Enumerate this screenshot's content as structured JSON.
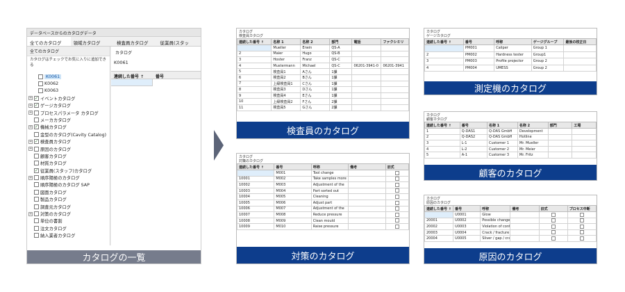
{
  "list_panel": {
    "window_title": "データベースからのカタログデータ",
    "tabs": [
      "全てのカタログ",
      "領域カタログ",
      "検査員カタログ",
      "従業員(スタッ"
    ],
    "left_header": "全てのカタログ",
    "hint": "カタログはチェックでお気に入りに追加できる",
    "tree": [
      {
        "label": "K0061",
        "checked": false,
        "selected": true,
        "expander": false,
        "indent": true
      },
      {
        "label": "K0062",
        "checked": false,
        "selected": false,
        "expander": false,
        "indent": true
      },
      {
        "label": "K0063",
        "checked": false,
        "selected": false,
        "expander": false,
        "indent": true
      },
      {
        "label": "イベントカタログ",
        "checked": true,
        "selected": false,
        "expander": true,
        "indent": false
      },
      {
        "label": "ゲージカタログ",
        "checked": true,
        "selected": false,
        "expander": true,
        "indent": false
      },
      {
        "label": "プロセスパラメータ カタログ",
        "checked": false,
        "selected": false,
        "expander": true,
        "indent": false
      },
      {
        "label": "メーカカタログ",
        "checked": false,
        "selected": false,
        "expander": false,
        "indent": false
      },
      {
        "label": "機械カタログ",
        "checked": true,
        "selected": false,
        "expander": true,
        "indent": false
      },
      {
        "label": "金型のカタログ(Cavity Catalog)",
        "checked": false,
        "selected": false,
        "expander": false,
        "indent": false
      },
      {
        "label": "検査員カタログ",
        "checked": true,
        "selected": false,
        "expander": true,
        "indent": false
      },
      {
        "label": "原因のカタログ",
        "checked": false,
        "selected": false,
        "expander": true,
        "indent": false
      },
      {
        "label": "顧客カタログ",
        "checked": false,
        "selected": false,
        "expander": false,
        "indent": false
      },
      {
        "label": "材質カタログ",
        "checked": false,
        "selected": false,
        "expander": false,
        "indent": false
      },
      {
        "label": "従業員(スタッフ)カタログ",
        "checked": true,
        "selected": false,
        "expander": false,
        "indent": false
      },
      {
        "label": "順序陽極のカタログ",
        "checked": false,
        "selected": false,
        "expander": true,
        "indent": false
      },
      {
        "label": "順序陽極のカタログ SAP",
        "checked": false,
        "selected": false,
        "expander": false,
        "indent": false
      },
      {
        "label": "図面カタログ",
        "checked": false,
        "selected": false,
        "expander": false,
        "indent": false
      },
      {
        "label": "製品カタログ",
        "checked": false,
        "selected": false,
        "expander": false,
        "indent": false
      },
      {
        "label": "調査元カタログ",
        "checked": false,
        "selected": false,
        "expander": false,
        "indent": false
      },
      {
        "label": "対策のカタログ",
        "checked": false,
        "selected": false,
        "expander": true,
        "indent": false
      },
      {
        "label": "単位の書割",
        "checked": false,
        "selected": false,
        "expander": false,
        "indent": false
      },
      {
        "label": "注文カタログ",
        "checked": false,
        "selected": false,
        "expander": false,
        "indent": false
      },
      {
        "label": "納入業者カタログ",
        "checked": false,
        "selected": false,
        "expander": false,
        "indent": false
      }
    ],
    "right_header": "カタログ",
    "right_value": "K0061",
    "grid_headers": [
      "連続した番号 ↑",
      "番号"
    ],
    "caption": "カタログの一覧"
  },
  "inspector": {
    "title": "カタログ",
    "subtitle": "検査員カタログ",
    "headers": [
      "連続した番号 ↑",
      "名称 1",
      "名称 2",
      "部門",
      "電話",
      "ファクシミリ"
    ],
    "rows": [
      [
        "",
        "Mueller",
        "Erwin",
        "QS-A",
        "",
        ""
      ],
      [
        "2",
        "Maier",
        "Hugo",
        "QS-B",
        "",
        ""
      ],
      [
        "3",
        "Hoster",
        "Franz",
        "QS-C",
        "",
        ""
      ],
      [
        "4",
        "Mustermann",
        "Michael",
        "QS-C",
        "06201-3941-0",
        "06201-3941"
      ],
      [
        "5",
        "検査員1",
        "Aさん",
        "1課",
        "",
        ""
      ],
      [
        "6",
        "検査員2",
        "Bさん",
        "1課",
        "",
        ""
      ],
      [
        "7",
        "上級検査員1",
        "Cさん",
        "1課",
        "",
        ""
      ],
      [
        "8",
        "検査員3",
        "Dさん",
        "1課",
        "",
        ""
      ],
      [
        "9",
        "検査員4",
        "Eさん",
        "1課",
        "",
        ""
      ],
      [
        "10",
        "上級検査員2",
        "Fさん",
        "2課",
        "",
        ""
      ],
      [
        "11",
        "検査員5",
        "Gさん",
        "2課",
        "",
        ""
      ]
    ],
    "caption": "検査員のカタログ"
  },
  "measuring": {
    "title": "カタログ",
    "subtitle": "ゲージカタログ",
    "headers": [
      "連続した番号 ↑",
      "番号",
      "呼称",
      "ゲージグループ",
      "最後の校正日"
    ],
    "rows": [
      [
        "",
        "PM001",
        "Caliper",
        "Group 1",
        ""
      ],
      [
        "2",
        "PM002",
        "Hardness tester",
        "Group1",
        ""
      ],
      [
        "3",
        "PM003",
        "Profile projector",
        "Group 2",
        ""
      ],
      [
        "4",
        "PM004",
        "UMESS",
        "Group 2",
        ""
      ]
    ],
    "caption": "測定機のカタログ"
  },
  "customer": {
    "title": "カタログ",
    "subtitle": "顧客カタログ",
    "headers": [
      "連続した番号 ↑",
      "番号",
      "名称 1",
      "名称 2",
      "部門",
      "工場"
    ],
    "rows": [
      [
        "1",
        "Q-DAS1",
        "Q-DAS GmbH",
        "Development",
        "",
        ""
      ],
      [
        "2",
        "Q-DAS2",
        "Q-DAS GmbH",
        "Hotline",
        "",
        ""
      ],
      [
        "3",
        "L-1",
        "Customer 1",
        "Mr. Mueller",
        "",
        ""
      ],
      [
        "4",
        "L-2",
        "Customer 2",
        "Mr. Meier",
        "",
        ""
      ],
      [
        "5",
        "A-1",
        "Customer 3",
        "Mr. Fritz",
        "",
        ""
      ]
    ],
    "caption": "顧客のカタログ"
  },
  "countermeasure": {
    "title": "カタログ",
    "subtitle": "対策のカタログ",
    "headers": [
      "連続した番号 ↑",
      "番号",
      "呼称",
      "備考",
      "旧式"
    ],
    "rows": [
      [
        "",
        "M001",
        "Tool change",
        "",
        ""
      ],
      [
        "10001",
        "M002",
        "Take samples more",
        "",
        ""
      ],
      [
        "10002",
        "M003",
        "Adjustment of the",
        "",
        ""
      ],
      [
        "10003",
        "M004",
        "Part sorted out",
        "",
        ""
      ],
      [
        "10004",
        "M005",
        "Cleaning",
        "",
        ""
      ],
      [
        "10005",
        "M006",
        "Adjust part",
        "",
        ""
      ],
      [
        "10006",
        "M007",
        "Adjustment of the",
        "",
        ""
      ],
      [
        "10007",
        "M008",
        "Reduce pressure",
        "",
        ""
      ],
      [
        "10008",
        "M009",
        "Clean mould",
        "",
        ""
      ],
      [
        "10009",
        "M010",
        "Raise pressure",
        "",
        ""
      ]
    ],
    "caption": "対策のカタログ"
  },
  "cause": {
    "title": "カタログ",
    "subtitle": "原因のカタログ",
    "headers": [
      "連続した番号 ↑",
      "番号",
      "呼称",
      "備考",
      "旧式",
      "プロセス中断"
    ],
    "rows": [
      [
        "",
        "U0001",
        "Glow",
        "",
        "",
        ""
      ],
      [
        "20001",
        "U0002",
        "Possible changes in",
        "",
        "",
        ""
      ],
      [
        "20002",
        "U0003",
        "Violation of control",
        "",
        "",
        ""
      ],
      [
        "20003",
        "U0004",
        "Crack / fracture /",
        "",
        "",
        ""
      ],
      [
        "20004",
        "U0005",
        "Sliver / gap / crack",
        "",
        "",
        ""
      ]
    ],
    "caption": "原因のカタログ"
  }
}
